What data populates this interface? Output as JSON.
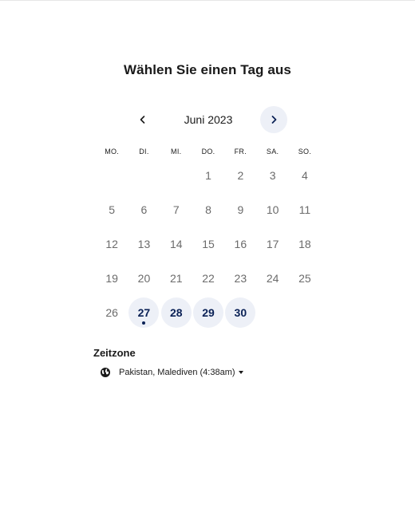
{
  "header": {
    "title": "Wählen Sie einen Tag aus"
  },
  "calendar": {
    "month_label": "Juni 2023",
    "prev_icon": "chevron-left-icon",
    "next_icon": "chevron-right-icon",
    "weekdays": [
      "MO.",
      "DI.",
      "MI.",
      "DO.",
      "FR.",
      "SA.",
      "SO."
    ],
    "leading_blanks": 3,
    "days": [
      {
        "n": "1",
        "available": false
      },
      {
        "n": "2",
        "available": false
      },
      {
        "n": "3",
        "available": false
      },
      {
        "n": "4",
        "available": false
      },
      {
        "n": "5",
        "available": false
      },
      {
        "n": "6",
        "available": false
      },
      {
        "n": "7",
        "available": false
      },
      {
        "n": "8",
        "available": false
      },
      {
        "n": "9",
        "available": false
      },
      {
        "n": "10",
        "available": false
      },
      {
        "n": "11",
        "available": false
      },
      {
        "n": "12",
        "available": false
      },
      {
        "n": "13",
        "available": false
      },
      {
        "n": "14",
        "available": false
      },
      {
        "n": "15",
        "available": false
      },
      {
        "n": "16",
        "available": false
      },
      {
        "n": "17",
        "available": false
      },
      {
        "n": "18",
        "available": false
      },
      {
        "n": "19",
        "available": false
      },
      {
        "n": "20",
        "available": false
      },
      {
        "n": "21",
        "available": false
      },
      {
        "n": "22",
        "available": false
      },
      {
        "n": "23",
        "available": false
      },
      {
        "n": "24",
        "available": false
      },
      {
        "n": "25",
        "available": false
      },
      {
        "n": "26",
        "available": false
      },
      {
        "n": "27",
        "available": true,
        "today": true
      },
      {
        "n": "28",
        "available": true
      },
      {
        "n": "29",
        "available": true
      },
      {
        "n": "30",
        "available": true
      }
    ]
  },
  "timezone": {
    "label": "Zeitzone",
    "value": "Pakistan, Malediven (4:38am)",
    "icon": "globe-icon"
  },
  "colors": {
    "accent": "#0a2156",
    "available_bg": "#edf0f7",
    "muted_text": "#6b6b6b"
  }
}
